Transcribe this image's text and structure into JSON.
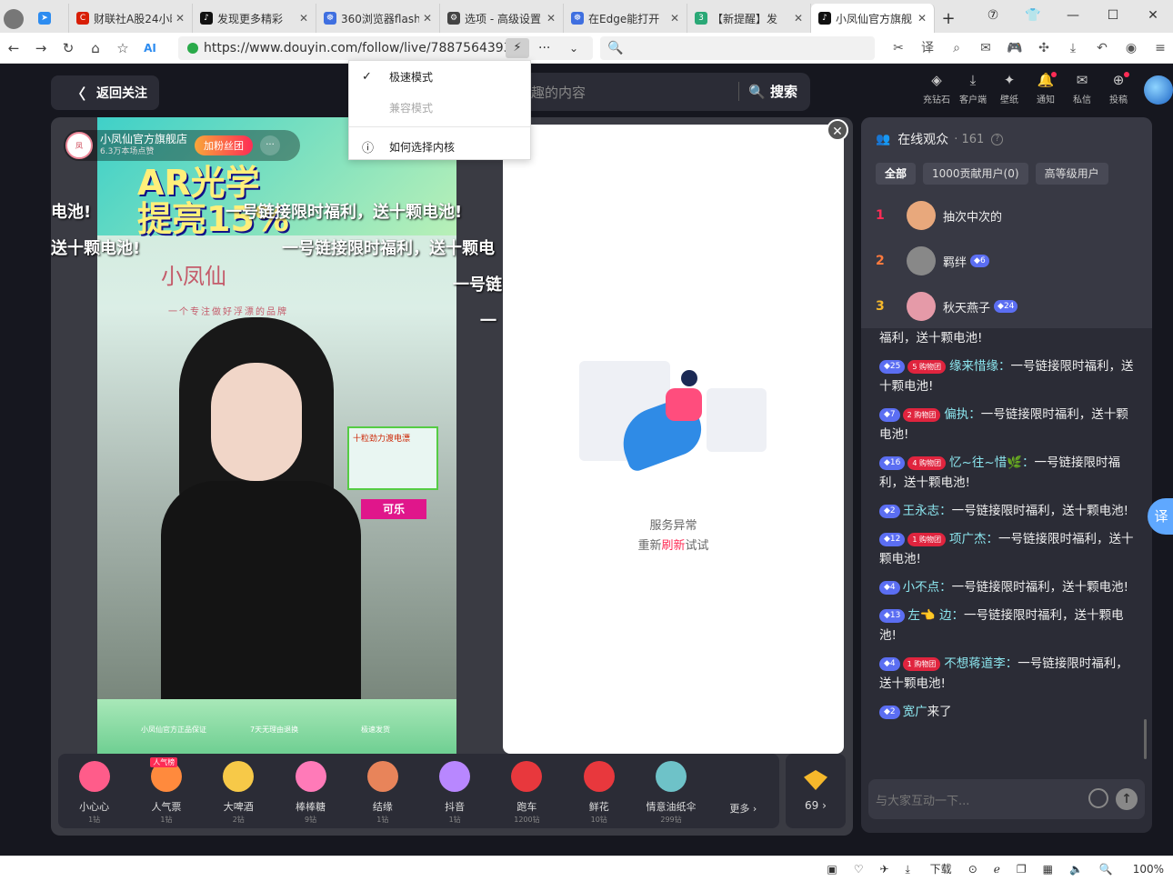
{
  "browser": {
    "tabs": [
      {
        "title": "财联社A股24小时",
        "fav_color": "#d81e06",
        "fav_text": "C"
      },
      {
        "title": "发现更多精彩",
        "fav_color": "#111111",
        "fav_text": "♪"
      },
      {
        "title": "360浏览器flash",
        "fav_color": "#3f6fe0",
        "fav_text": "☸"
      },
      {
        "title": "选项 - 高级设置",
        "fav_color": "#444444",
        "fav_text": "⚙"
      },
      {
        "title": "在Edge能打开",
        "fav_color": "#3f6fe0",
        "fav_text": "☸"
      },
      {
        "title": "【新提醒】发",
        "fav_color": "#2aa876",
        "fav_text": "3"
      },
      {
        "title": "小凤仙官方旗舰",
        "fav_color": "#111111",
        "fav_text": "♪"
      }
    ],
    "url": "https://www.douyin.com/follow/live/7887564393",
    "kernel_menu": {
      "items": [
        "极速模式",
        "兼容模式",
        "如何选择内核"
      ]
    },
    "status": {
      "download": "下载",
      "zoom": "100%"
    }
  },
  "douyin": {
    "back_label": "返回关注",
    "search_placeholder": "趣的内容",
    "search_btn": "搜索",
    "top_icons": [
      {
        "label": "充钻石",
        "glyph": "◈"
      },
      {
        "label": "客户端",
        "glyph": "⤓"
      },
      {
        "label": "壁纸",
        "glyph": "✦"
      },
      {
        "label": "通知",
        "glyph": "🔔"
      },
      {
        "label": "私信",
        "glyph": "✉"
      },
      {
        "label": "投稿",
        "glyph": "⊕"
      }
    ]
  },
  "live": {
    "streamer_name": "小凤仙官方旗舰店",
    "streamer_likes": "6.3万本场点赞",
    "fan_btn": "加粉丝团",
    "poster_text_1": "AR光学",
    "poster_text_2": "提亮15%",
    "brand": "小凤仙",
    "brand_slogan": "一个专注做好浮漂的品牌",
    "product_title": "十粒劲力渡电漂",
    "product_tag": "可乐",
    "danmu": [
      "电池!",
      "一号链接限时福利，送十颗电池!",
      "送十颗电池!",
      "一号链接限时福利，送十颗电",
      "一号链",
      "一"
    ],
    "video_bottom": [
      "小凤仙官方正品保证",
      "7天无理由退换",
      "极速发货"
    ],
    "error": {
      "title": "服务异常",
      "retry_prefix": "重新",
      "retry_link": "刷新",
      "retry_suffix": "试试"
    },
    "gifts": [
      {
        "name": "小心心",
        "price": "1钻",
        "color": "#ff5c8a"
      },
      {
        "name": "人气票",
        "price": "1钻",
        "color": "#ff8a3d",
        "hot": "人气榜"
      },
      {
        "name": "大啤酒",
        "price": "2钻",
        "color": "#f7c948"
      },
      {
        "name": "棒棒糖",
        "price": "9钻",
        "color": "#ff7ab8"
      },
      {
        "name": "结缘",
        "price": "1钻",
        "color": "#e8845a"
      },
      {
        "name": "抖音",
        "price": "1钻",
        "color": "#b887ff"
      },
      {
        "name": "跑车",
        "price": "1200钻",
        "color": "#e8383d"
      },
      {
        "name": "鲜花",
        "price": "10钻",
        "color": "#e8383d"
      },
      {
        "name": "情意油纸伞",
        "price": "299钻",
        "color": "#6ec2c8"
      }
    ],
    "more_label": "更多",
    "coins": "69"
  },
  "side": {
    "title": "在线观众",
    "count": "161",
    "chips": [
      "全部",
      "1000贡献用户(0)",
      "高等级用户"
    ],
    "ranks": [
      {
        "n": "1",
        "name": "抽次中次的",
        "color": "#e8a87c",
        "rank_color": "#fe2c55"
      },
      {
        "n": "2",
        "name": "羁绊",
        "lvl": "6",
        "color": "#888888",
        "rank_color": "#ff7a3d"
      },
      {
        "n": "3",
        "name": "秋天燕子",
        "lvl": "24",
        "color": "#e59aa8",
        "rank_color": "#f5b82b"
      }
    ],
    "messages": [
      {
        "text": "福利，送十颗电池!"
      },
      {
        "lvl": "25",
        "fans": "5",
        "user": "缘来惜缘：",
        "text": "一号链接限时福利，送十颗电池!"
      },
      {
        "lvl": "7",
        "fans": "2",
        "user": "偏执：",
        "text": "一号链接限时福利，送十颗电池!"
      },
      {
        "lvl": "16",
        "fans": "4",
        "user": "忆~往~惜🌿：",
        "text": "一号链接限时福利，送十颗电池!"
      },
      {
        "lvl": "2",
        "user": "王永志：",
        "text": "一号链接限时福利，送十颗电池!"
      },
      {
        "lvl": "12",
        "fans": "1",
        "user": "项广杰：",
        "text": "一号链接限时福利，送十颗电池!"
      },
      {
        "lvl": "4",
        "user": "小不点：",
        "text": "一号链接限时福利，送十颗电池!"
      },
      {
        "lvl": "13",
        "user": "左👈 边：",
        "text": "一号链接限时福利，送十颗电池!"
      },
      {
        "lvl": "4",
        "fans": "1",
        "user": "不想蒋道李：",
        "text": "一号链接限时福利，送十颗电池!"
      },
      {
        "lvl": "2",
        "user": "宽广",
        "text": "来了"
      }
    ],
    "input_placeholder": "与大家互动一下..."
  }
}
